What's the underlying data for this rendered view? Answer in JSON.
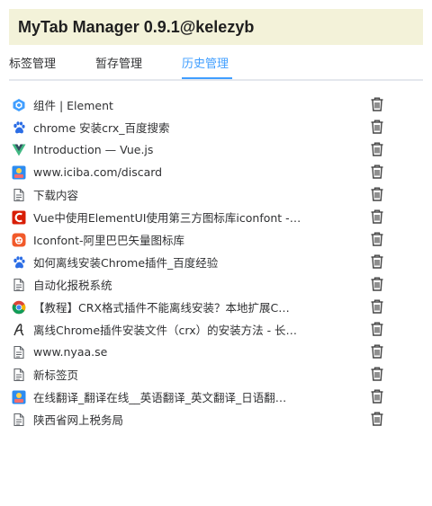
{
  "app": {
    "title": "MyTab Manager 0.9.1@kelezyb"
  },
  "tabs": [
    {
      "label": "标签管理"
    },
    {
      "label": "暂存管理"
    },
    {
      "label": "历史管理"
    }
  ],
  "active_tab_color": "#409eff",
  "history": [
    {
      "title": "组件 | Element",
      "icon": "element-icon"
    },
    {
      "title": "chrome 安装crx_百度搜索",
      "icon": "baidu-paw-icon"
    },
    {
      "title": "Introduction — Vue.js",
      "icon": "vue-icon"
    },
    {
      "title": "www.iciba.com/discard",
      "icon": "iciba-icon"
    },
    {
      "title": "下载内容",
      "icon": "page-icon"
    },
    {
      "title": "Vue中使用ElementUI使用第三方图标库iconfont - …",
      "icon": "csdn-icon"
    },
    {
      "title": "Iconfont-阿里巴巴矢量图标库",
      "icon": "iconfont-icon"
    },
    {
      "title": "如何离线安装Chrome插件_百度经验",
      "icon": "baidu-paw-icon"
    },
    {
      "title": "自动化报税系统",
      "icon": "page-icon"
    },
    {
      "title": "【教程】CRX格式插件不能离线安装？本地扩展C…",
      "icon": "chrome-icon"
    },
    {
      "title": "离线Chrome插件安装文件（crx）的安装方法 - 长…",
      "icon": "script-a-icon"
    },
    {
      "title": "www.nyaa.se",
      "icon": "page-icon"
    },
    {
      "title": "新标签页",
      "icon": "page-icon"
    },
    {
      "title": "在线翻译_翻译在线__英语翻译_英文翻译_日语翻…",
      "icon": "iciba-icon"
    },
    {
      "title": "陕西省网上税务局",
      "icon": "page-icon"
    }
  ]
}
